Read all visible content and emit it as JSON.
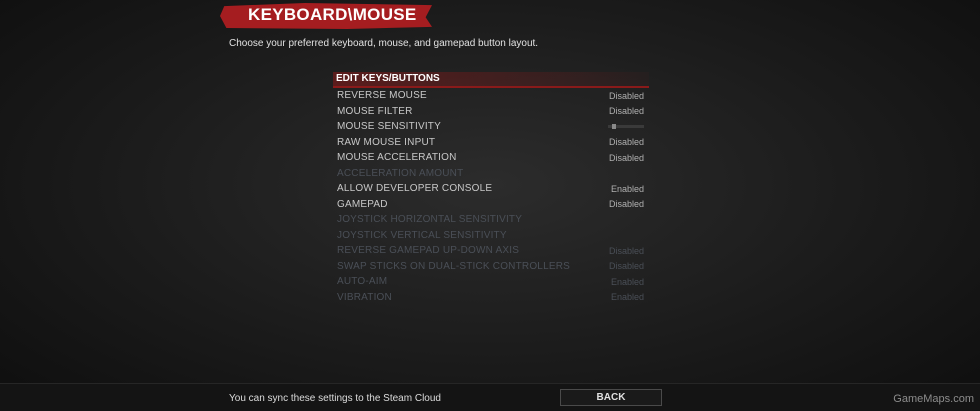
{
  "header": {
    "title": "KEYBOARD\\MOUSE",
    "subtitle": "Choose your preferred keyboard, mouse, and gamepad button layout."
  },
  "section": {
    "label": "EDIT KEYS/BUTTONS"
  },
  "settings": [
    {
      "label": "REVERSE MOUSE",
      "value": "Disabled"
    },
    {
      "label": "MOUSE FILTER",
      "value": "Disabled"
    },
    {
      "label": "MOUSE SENSITIVITY",
      "value": "",
      "slider_fraction": 0.1
    },
    {
      "label": "RAW MOUSE INPUT",
      "value": "Disabled"
    },
    {
      "label": "MOUSE ACCELERATION",
      "value": "Disabled"
    },
    {
      "label": "ACCELERATION AMOUNT",
      "value": ""
    },
    {
      "label": "ALLOW DEVELOPER CONSOLE",
      "value": "Enabled"
    },
    {
      "label": "GAMEPAD",
      "value": "Disabled"
    },
    {
      "label": "JOYSTICK HORIZONTAL SENSITIVITY",
      "value": ""
    },
    {
      "label": "JOYSTICK VERTICAL SENSITIVITY",
      "value": ""
    },
    {
      "label": "REVERSE GAMEPAD UP-DOWN AXIS",
      "value": "Disabled"
    },
    {
      "label": "SWAP STICKS ON DUAL-STICK CONTROLLERS",
      "value": "Disabled"
    },
    {
      "label": "AUTO-AIM",
      "value": "Enabled"
    },
    {
      "label": "VIBRATION",
      "value": "Enabled"
    }
  ],
  "footer": {
    "sync_text": "You can sync these settings to the Steam Cloud",
    "back_label": "BACK",
    "watermark": "GameMaps.com"
  }
}
